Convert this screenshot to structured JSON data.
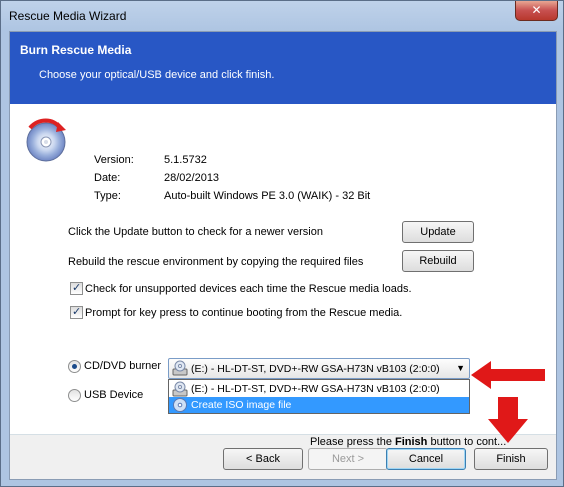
{
  "window": {
    "title": "Rescue Media Wizard",
    "close_label": "✕"
  },
  "banner": {
    "title": "Burn Rescue Media",
    "subtitle": "Choose your optical/USB device and click finish."
  },
  "info": [
    {
      "label": "Version:",
      "value": "5.1.5732"
    },
    {
      "label": "Date:",
      "value": "28/02/2013"
    },
    {
      "label": "Type:",
      "value": "Auto-built Windows PE 3.0 (WAIK) - 32 Bit"
    }
  ],
  "actions": {
    "update_text": "Click the Update button to check for a newer version",
    "update_button": "Update",
    "rebuild_text": "Rebuild the rescue environment by copying the required files",
    "rebuild_button": "Rebuild"
  },
  "options": {
    "check_unsupported": "Check for unsupported devices each time the Rescue media loads.",
    "prompt_keypress": "Prompt for key press to continue booting from the Rescue media."
  },
  "device": {
    "cd_label": "CD/DVD burner",
    "usb_label": "USB Device",
    "selected": "(E:) - HL-DT-ST, DVD+-RW GSA-H73N vB103 (2:0:0)",
    "dropdown_items": [
      "(E:) - HL-DT-ST, DVD+-RW GSA-H73N vB103 (2:0:0)",
      "Create ISO image file"
    ]
  },
  "hint": {
    "prefix": "Please press the ",
    "bold": "Finish",
    "suffix": " button to cont..."
  },
  "footer": {
    "back": "< Back",
    "next": "Next >",
    "cancel": "Cancel",
    "finish": "Finish"
  },
  "colors": {
    "banner": "#2857c5",
    "selection": "#3399ff",
    "annotation_arrow": "#e01818"
  },
  "icons": [
    "cd-disc-icon",
    "drive-icon",
    "iso-icon",
    "red-arrow-icon"
  ]
}
